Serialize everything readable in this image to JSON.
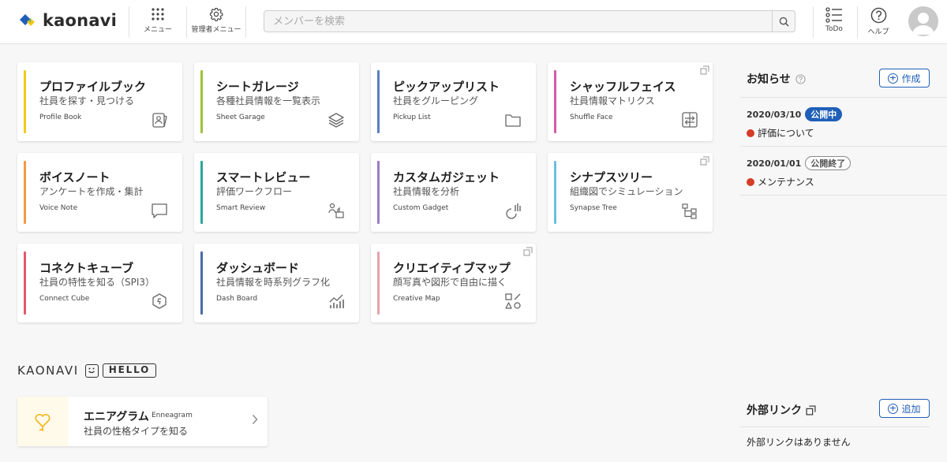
{
  "header": {
    "logo_text": "kaonavi",
    "menu_label": "メニュー",
    "admin_menu_label": "管理者メニュー",
    "search_placeholder": "メンバーを検索",
    "todo_label": "ToDo",
    "help_label": "ヘルプ"
  },
  "cards": [
    {
      "title": "プロファイルブック",
      "subtitle": "社員を探す・見つける",
      "en": "Profile Book",
      "color": "#f2c91c",
      "icon": "profile-book-icon"
    },
    {
      "title": "シートガレージ",
      "subtitle": "各種社員情報を一覧表示",
      "en": "Sheet Garage",
      "color": "#9cc23a",
      "icon": "layers-icon"
    },
    {
      "title": "ピックアップリスト",
      "subtitle": "社員をグルーピング",
      "en": "Pickup List",
      "color": "#5a7fc2",
      "icon": "folder-icon"
    },
    {
      "title": "シャッフルフェイス",
      "subtitle": "社員情報マトリクス",
      "en": "Shuffle Face",
      "color": "#d55aa8",
      "icon": "shuffle-icon"
    },
    {
      "title": "ボイスノート",
      "subtitle": "アンケートを作成・集計",
      "en": "Voice Note",
      "color": "#f29a47",
      "icon": "speech-bubble-icon"
    },
    {
      "title": "スマートレビュー",
      "subtitle": "評価ワークフロー",
      "en": "Smart Review",
      "color": "#2aa79b",
      "icon": "review-icon"
    },
    {
      "title": "カスタムガジェット",
      "subtitle": "社員情報を分析",
      "en": "Custom Gadget",
      "color": "#9b7cc4",
      "icon": "gadget-chart-icon"
    },
    {
      "title": "シナプスツリー",
      "subtitle": "組織図でシミュレーション",
      "en": "Synapse Tree",
      "color": "#6bbfe0",
      "icon": "org-tree-icon"
    },
    {
      "title": "コネクトキューブ",
      "subtitle": "社員の特性を知る（SPI3）",
      "en": "Connect Cube",
      "color": "#e05a6a",
      "icon": "cube-icon"
    },
    {
      "title": "ダッシュボード",
      "subtitle": "社員情報を時系列グラフ化",
      "en": "Dash Board",
      "color": "#4a6aa8",
      "icon": "dashboard-chart-icon"
    },
    {
      "title": "クリエイティブマップ",
      "subtitle": "顔写真や図形で自由に描く",
      "en": "Creative Map",
      "color": "#e7a3ad",
      "icon": "shapes-icon"
    }
  ],
  "hello": {
    "kaonavi_text": "KAONAVI",
    "hello_text": "HELLO",
    "enneagram_title": "エニアグラム",
    "enneagram_en": "Enneagram",
    "enneagram_subtitle": "社員の性格タイプを知る"
  },
  "notices": {
    "title": "お知らせ",
    "create_label": "作成",
    "items": [
      {
        "date": "2020/03/10",
        "status": "公開中",
        "title": "評価について"
      },
      {
        "date": "2020/01/01",
        "status": "公開終了",
        "title": "メンテナンス"
      }
    ]
  },
  "links": {
    "title": "外部リンク",
    "add_label": "追加",
    "empty_text": "外部リンクはありません"
  }
}
